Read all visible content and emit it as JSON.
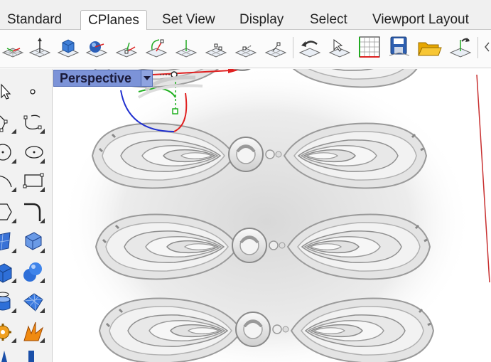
{
  "ribbon": {
    "tabs": [
      {
        "label": "Standard",
        "active": false
      },
      {
        "label": "CPlanes",
        "active": true
      },
      {
        "label": "Set View",
        "active": false
      },
      {
        "label": "Display",
        "active": false
      },
      {
        "label": "Select",
        "active": false
      },
      {
        "label": "Viewport Layout",
        "active": false
      }
    ]
  },
  "toolbar": {
    "buttons": [
      {
        "icon": "cplane-grid-icon"
      },
      {
        "icon": "cplane-origin-icon"
      },
      {
        "icon": "cplane-to-object-icon"
      },
      {
        "icon": "cplane-to-surface-icon"
      },
      {
        "icon": "cplane-by-3-points-icon"
      },
      {
        "icon": "cplane-rotate-icon"
      },
      {
        "icon": "cplane-elevation-icon"
      },
      {
        "icon": "cplane-x-axis-icon"
      },
      {
        "icon": "cplane-z-axis-icon"
      },
      {
        "icon": "cplane-perpendicular-icon"
      },
      {
        "icon": "undo-cplane-icon"
      },
      {
        "icon": "cplane-view-icon"
      },
      {
        "icon": "named-cplanes-grid-icon"
      },
      {
        "icon": "save-cplane-icon"
      },
      {
        "icon": "open-cplane-folder-icon"
      },
      {
        "icon": "cplane-world-icon"
      }
    ]
  },
  "palette": {
    "buttons": [
      {
        "icon": "select-arrow-icon"
      },
      {
        "icon": "point-icon"
      },
      {
        "icon": "polyline-icon"
      },
      {
        "icon": "curve-icon"
      },
      {
        "icon": "circle-icon"
      },
      {
        "icon": "ellipse-icon"
      },
      {
        "icon": "arc-icon"
      },
      {
        "icon": "rectangle-icon"
      },
      {
        "icon": "polygon-icon"
      },
      {
        "icon": "fillet-curve-icon"
      },
      {
        "icon": "surface-from-points-icon"
      },
      {
        "icon": "extrude-surface-icon"
      },
      {
        "icon": "box-solid-icon"
      },
      {
        "icon": "sphere-solid-icon"
      },
      {
        "icon": "cylinder-solid-icon"
      },
      {
        "icon": "mesh-icon"
      },
      {
        "icon": "transform-gear-icon"
      },
      {
        "icon": "explode-icon"
      },
      {
        "icon": "dimension-icon"
      },
      {
        "icon": "analyze-icon"
      }
    ]
  },
  "viewport": {
    "title": "Perspective",
    "axis_colors": {
      "x": "#e02020",
      "y": "#20b020",
      "z": "#2030d0"
    }
  }
}
